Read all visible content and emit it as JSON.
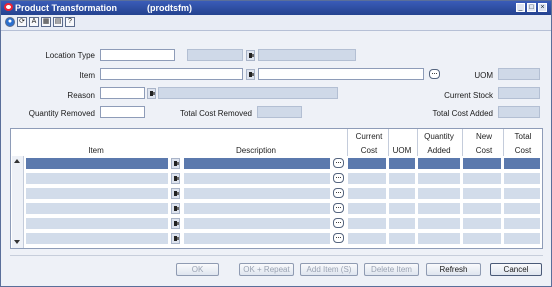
{
  "window": {
    "title": "Product Transformation",
    "form_code": "(prodtsfm)",
    "minimize_glyph": "_",
    "maximize_glyph": "□",
    "close_glyph": "×"
  },
  "toolbar": {
    "icons": [
      "globe-icon",
      "refresh-icon",
      "spell-check-icon",
      "calculator-icon",
      "copy-icon",
      "help-icon"
    ],
    "glyphs": [
      "●",
      "⟳",
      "A",
      "▦",
      "▤",
      "?"
    ]
  },
  "form": {
    "location_type": {
      "label": "Location Type",
      "value": ""
    },
    "item": {
      "label": "Item",
      "value": ""
    },
    "reason": {
      "label": "Reason",
      "value": ""
    },
    "quantity_removed": {
      "label": "Quantity Removed",
      "value": ""
    },
    "total_cost_removed": {
      "label": "Total Cost Removed",
      "value": ""
    },
    "uom": {
      "label": "UOM",
      "value": ""
    },
    "current_stock": {
      "label": "Current Stock",
      "value": ""
    },
    "total_cost_added": {
      "label": "Total Cost Added",
      "value": ""
    }
  },
  "grid": {
    "columns": {
      "item": "Item",
      "description": "Description",
      "current_cost": [
        "Current",
        "Cost"
      ],
      "uom": "UOM",
      "quantity_added": [
        "Quantity",
        "Added"
      ],
      "new_cost": [
        "New",
        "Cost"
      ],
      "total_cost": [
        "Total",
        "Cost"
      ]
    },
    "row_count": 6,
    "selected_row": 0
  },
  "buttons": {
    "ok": "OK",
    "ok_repeat": "OK + Repeat",
    "add_item": "Add Item (S)",
    "delete_item": "Delete Item",
    "refresh": "Refresh",
    "cancel": "Cancel"
  },
  "colors": {
    "titlebar": "#2f4fa6",
    "selected_row": "#5b79ad",
    "readonly_field": "#cfd9e8"
  }
}
